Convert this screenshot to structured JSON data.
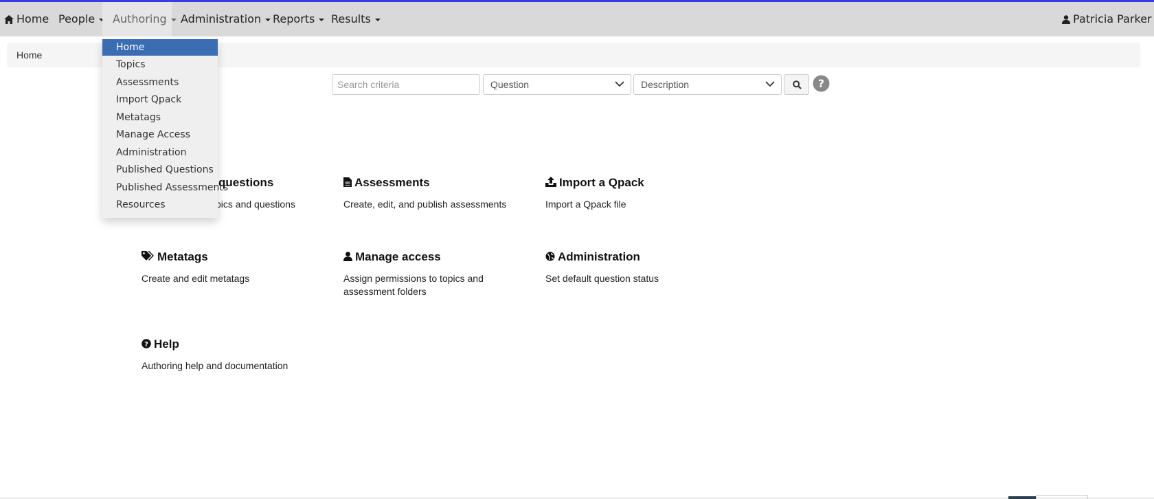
{
  "nav": {
    "home": "Home",
    "people": "People",
    "authoring": "Authoring",
    "administration": "Administration",
    "reports": "Reports",
    "results": "Results",
    "user": "Patricia Parker"
  },
  "breadcrumb": {
    "home": "Home"
  },
  "search": {
    "placeholder": "Search criteria",
    "type_selected": "Question",
    "field_selected": "Description"
  },
  "authoring_menu": [
    "Home",
    "Topics",
    "Assessments",
    "Import Qpack",
    "Metatags",
    "Manage Access",
    "Administration",
    "Published Questions",
    "Published Assessments",
    "Resources"
  ],
  "cards": {
    "topics": {
      "title": "questions",
      "desc": "pics and questions"
    },
    "assessments": {
      "title": "Assessments",
      "desc": "Create, edit, and publish assessments"
    },
    "import": {
      "title": "Import a Qpack",
      "desc": "Import a Qpack file"
    },
    "metatags": {
      "title": "Metatags",
      "desc": "Create and edit metatags"
    },
    "access": {
      "title": "Manage access",
      "desc": "Assign permissions to topics and assessment folders"
    },
    "administration": {
      "title": "Administration",
      "desc": "Set default question status"
    },
    "help": {
      "title": "Help",
      "desc": "Authoring help and documentation"
    }
  },
  "colors": {
    "accent": "#3a3ae8",
    "menu_selected": "#3b6db3",
    "navbar": "#d9d9d9"
  }
}
